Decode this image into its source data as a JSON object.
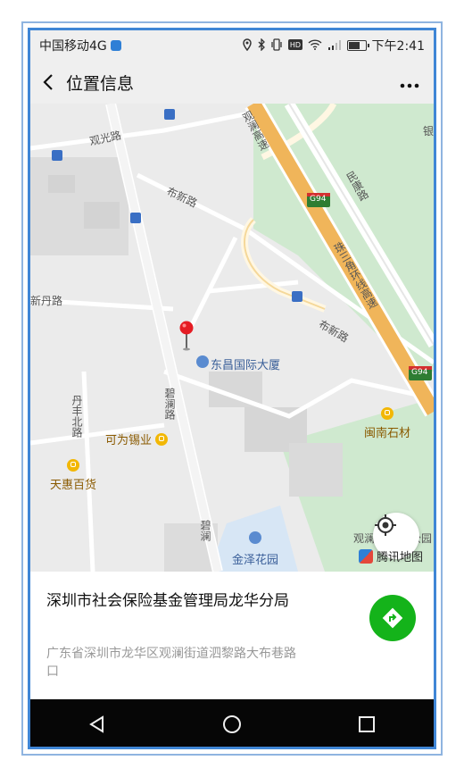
{
  "status": {
    "carrier": "中国移动4G",
    "time": "下午2:41",
    "icons": [
      "location-icon",
      "bluetooth-icon",
      "vibrate-icon",
      "hd-icon",
      "wifi-icon",
      "signal-icon",
      "battery-icon"
    ]
  },
  "nav": {
    "title": "位置信息"
  },
  "map": {
    "roads": {
      "guanguang": "观光路",
      "buxin_top": "布新路",
      "buxin_right": "布新路",
      "xindan": "新丹路",
      "bilan": "碧澜路",
      "bilan2": "碧澜",
      "danfengbei": "丹丰北路",
      "guanlan_expy": "观澜高速",
      "delta_ring": "珠三角环线高速",
      "minkang": "民康路",
      "g94_1": "G94",
      "g94_2": "G94",
      "yin": "银",
      "guanlan_park": "观澜",
      "park": "公园"
    },
    "pois": {
      "dongchang": "东昌国际大厦",
      "keweixi": "可为锡业",
      "tianhui": "天惠百货",
      "minnan": "闽南石材",
      "jinze": "金泽花园"
    },
    "provider": "腾讯地图"
  },
  "place": {
    "name": "深圳市社会保险基金管理局龙华分局",
    "address": "广东省深圳市龙华区观澜街道泗黎路大布巷路口"
  },
  "colors": {
    "green_button": "#14b31a",
    "poi_yellow": "#f2b705",
    "expressway": "#f0b55a",
    "greenland": "#cfe9cf"
  }
}
